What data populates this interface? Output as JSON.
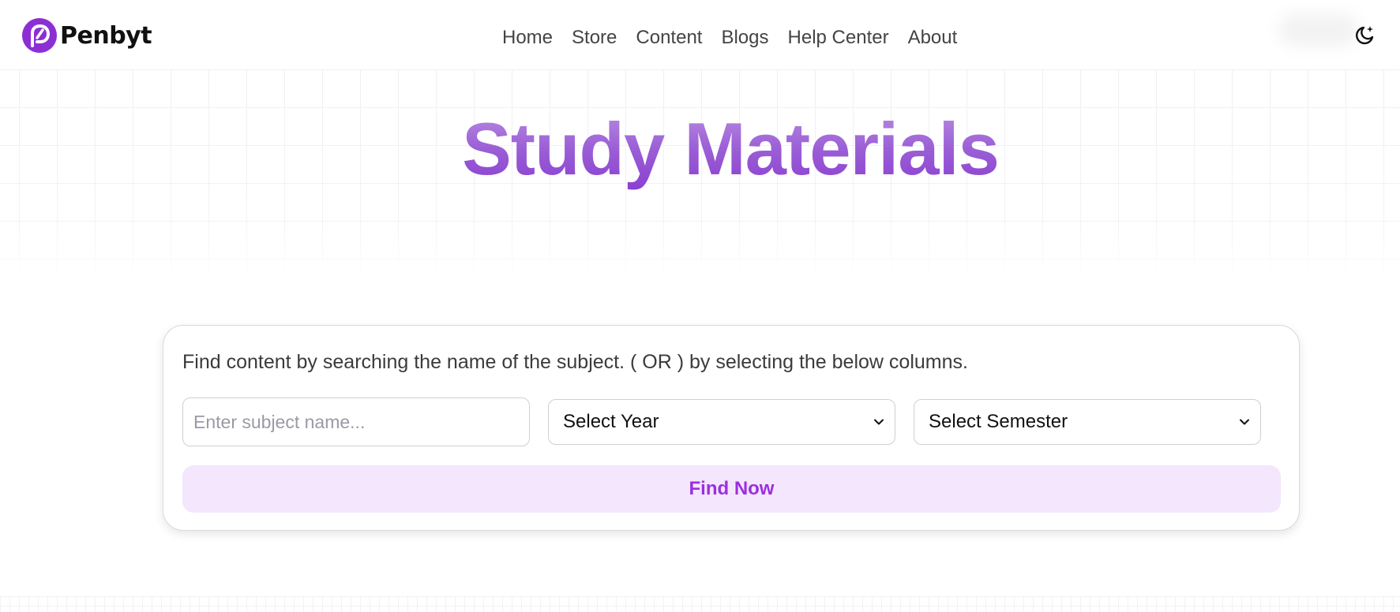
{
  "brand": {
    "name": "Penbyt",
    "accent_color": "#8b2fd4"
  },
  "nav": {
    "items": [
      {
        "label": "Home"
      },
      {
        "label": "Store"
      },
      {
        "label": "Content"
      },
      {
        "label": "Blogs"
      },
      {
        "label": "Help Center"
      },
      {
        "label": "About"
      }
    ]
  },
  "header": {
    "theme_toggle_icon": "moon-sparkle-icon"
  },
  "hero": {
    "title": "Study Materials",
    "gradient": [
      "#b98ee0",
      "#8a3fd1"
    ]
  },
  "search": {
    "description": "Find content by searching the name of the subject. ( OR ) by selecting the below columns.",
    "subject_placeholder": "Enter subject name...",
    "subject_value": "",
    "year_select": {
      "selected": "Select Year"
    },
    "semester_select": {
      "selected": "Select Semester"
    },
    "submit_label": "Find Now",
    "button_bg": "#f3e6fd",
    "button_text_color": "#9c2ee0"
  }
}
